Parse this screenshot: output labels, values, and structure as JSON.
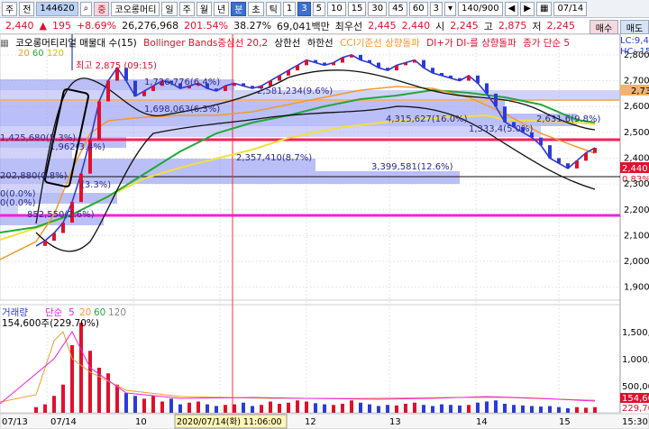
{
  "toolbar": {
    "code": "144620",
    "stock_name": "코오롱머티",
    "period_tabs": [
      "일",
      "주",
      "월",
      "년",
      "분",
      "초",
      "틱"
    ],
    "interval_tabs": [
      "1",
      "3",
      "5",
      "10",
      "15",
      "30",
      "45",
      "60"
    ],
    "unit_value": "3",
    "count": "140/900",
    "date": "07/14",
    "left_labels": [
      "주",
      "전"
    ]
  },
  "quote": {
    "price": "2,440",
    "change": "195",
    "change_pct": "+8.69%",
    "volume": "26,276,968",
    "vol_ratio": "201.54%",
    "turnover": "38.27%",
    "amount": "69,041백만",
    "best_label": "최우선",
    "best_ask": "2,445",
    "best_bid": "2,440",
    "open_label": "시",
    "open": "2,245",
    "high_label": "고",
    "high": "2,875",
    "low_label": "저",
    "low": "2,245"
  },
  "legend": {
    "title": "코오롱머티리얼 매물대 수(15)",
    "bollinger": "Bollinger Bands중심선 20,2",
    "upper": "상한선",
    "lower": "하한선",
    "cci": "CCI기준선 상향돌파",
    "di": "DI+가 DI-를 상향돌파",
    "close": "종가 단순 5",
    "ma_periods": [
      "20",
      "60",
      "120"
    ],
    "side_label1": "LC:9,46",
    "side_label2": "HC:-15"
  },
  "top_annotation": "최고 2,875 (09:15)",
  "profile_labels": [
    {
      "text": "1,726,776(6.4%)"
    },
    {
      "text": "2,581,234(9.6%)"
    },
    {
      "text": "1,698,063(6.3%)"
    },
    {
      "text": "4,315,627(16.0%)"
    },
    {
      "text": "2,631,6(9.8%)"
    },
    {
      "text": "1,333,4(5.0%)"
    },
    {
      "text": "1,425,680(5.3%)"
    },
    {
      "text": "1,962(3.4%)"
    },
    {
      "text": "2,357,410(8.7%)"
    },
    {
      "text": "3,399,581(12.6%)"
    },
    {
      "text": "202,880(0.8%)"
    },
    {
      "text": "(3.3%)"
    },
    {
      "text": "0(0.0%)"
    },
    {
      "text": "0(0.0%)"
    },
    {
      "text": "852,550(2.6%)"
    }
  ],
  "price_axis": {
    "ticks": [
      "2,800",
      "2,700",
      "2,600",
      "2,500",
      "2,400",
      "2,300",
      "2,200",
      "2,100",
      "2,000",
      "1,900"
    ],
    "current": "2,440",
    "current_pct": "0.83%",
    "tag_high": "2,73"
  },
  "volume_panel": {
    "legend_label": "거래량",
    "simple": "단순",
    "periods": [
      "5",
      "20",
      "60",
      "120"
    ],
    "peak_label": "154,600주(229.70%)",
    "ticks": [
      "1,500,",
      "1,000,",
      "500,000"
    ],
    "current": "154,60",
    "current2": "229,70"
  },
  "time_axis": {
    "labels": [
      "07/13",
      "07/14",
      "10",
      "2020/07/14(화) 11:06:00",
      "12",
      "13",
      "14",
      "15",
      "15:30"
    ]
  },
  "side_buttons": [
    "매수",
    "매도"
  ],
  "chart_data": {
    "type": "line",
    "title": "코오롱머티리얼",
    "ylim": [
      1850,
      2880
    ],
    "price_series": [
      2060,
      2080,
      2110,
      2150,
      2230,
      2340,
      2470,
      2620,
      2700,
      2750,
      2700,
      2640,
      2660,
      2680,
      2700,
      2690,
      2670,
      2680,
      2690,
      2670,
      2660,
      2680,
      2690,
      2680,
      2670,
      2680,
      2700,
      2720,
      2740,
      2760,
      2780,
      2770,
      2760,
      2770,
      2790,
      2800,
      2780,
      2770,
      2750,
      2740,
      2760,
      2770,
      2780,
      2750,
      2730,
      2720,
      2710,
      2700,
      2720,
      2690,
      2650,
      2600,
      2540,
      2520,
      2500,
      2480,
      2450,
      2400,
      2380,
      2360,
      2390,
      2420,
      2440
    ],
    "volume_series": [
      0.1,
      0.15,
      0.3,
      0.5,
      1.2,
      1.6,
      1.1,
      0.8,
      0.7,
      0.5,
      0.35,
      0.3,
      0.25,
      0.3,
      0.2,
      0.25,
      0.15,
      0.18,
      0.2,
      0.15,
      0.12,
      0.14,
      0.15,
      0.18,
      0.12,
      0.14,
      0.2,
      0.16,
      0.18,
      0.22,
      0.2,
      0.17,
      0.15,
      0.14,
      0.16,
      0.22,
      0.18,
      0.15,
      0.12,
      0.14,
      0.13,
      0.16,
      0.18,
      0.14,
      0.12,
      0.15,
      0.14,
      0.13,
      0.14,
      0.18,
      0.2,
      0.22,
      0.16,
      0.14,
      0.13,
      0.12,
      0.11,
      0.12,
      0.1,
      0.08,
      0.1,
      0.09,
      0.1
    ]
  }
}
